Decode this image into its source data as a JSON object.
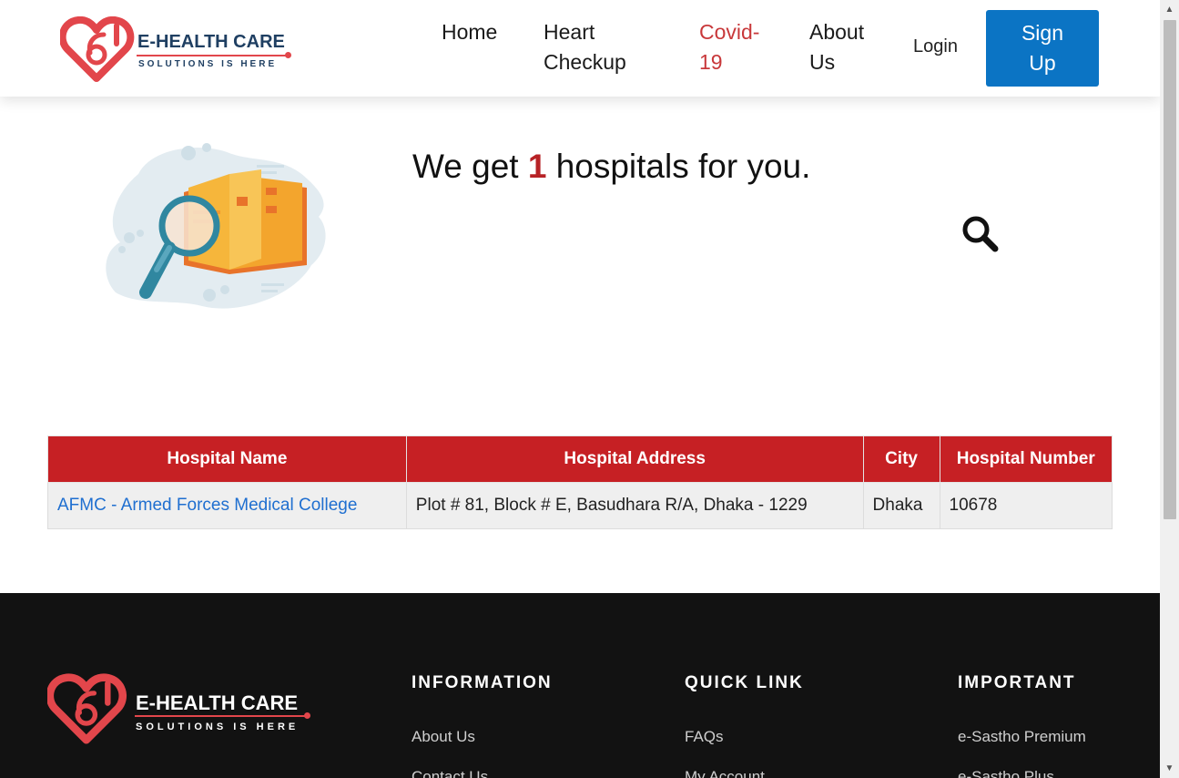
{
  "brand": {
    "name": "E-HEALTH CARE",
    "tagline": "SOLUTIONS IS HERE",
    "colors": {
      "red": "#e2464b",
      "navy": "#1f3f62",
      "blue": "#0b74c4"
    }
  },
  "nav": {
    "items": [
      {
        "label": "Home"
      },
      {
        "label": "Heart Checkup"
      },
      {
        "label": "Covid-19"
      },
      {
        "label": "About Us"
      }
    ],
    "login": "Login",
    "signup": "Sign Up"
  },
  "hero": {
    "prefix": "We get",
    "count": "1",
    "suffix": "hospitals for you.",
    "search_icon": "search-icon"
  },
  "table": {
    "headers": [
      "Hospital Name",
      "Hospital Address",
      "City",
      "Hospital Number"
    ],
    "rows": [
      {
        "name": "AFMC - Armed Forces Medical College",
        "address": "Plot # 81, Block # E, Basudhara R/A, Dhaka - 1229",
        "city": "Dhaka",
        "number": "10678"
      }
    ]
  },
  "footer": {
    "information": {
      "title": "INFORMATION",
      "links": [
        "About Us",
        "Contact Us"
      ]
    },
    "quick_link": {
      "title": "QUICK LINK",
      "links": [
        "FAQs",
        "My Account"
      ]
    },
    "important": {
      "title": "IMPORTANT",
      "links": [
        "e-Sastho Premium",
        "e-Sastho Plus"
      ]
    }
  }
}
